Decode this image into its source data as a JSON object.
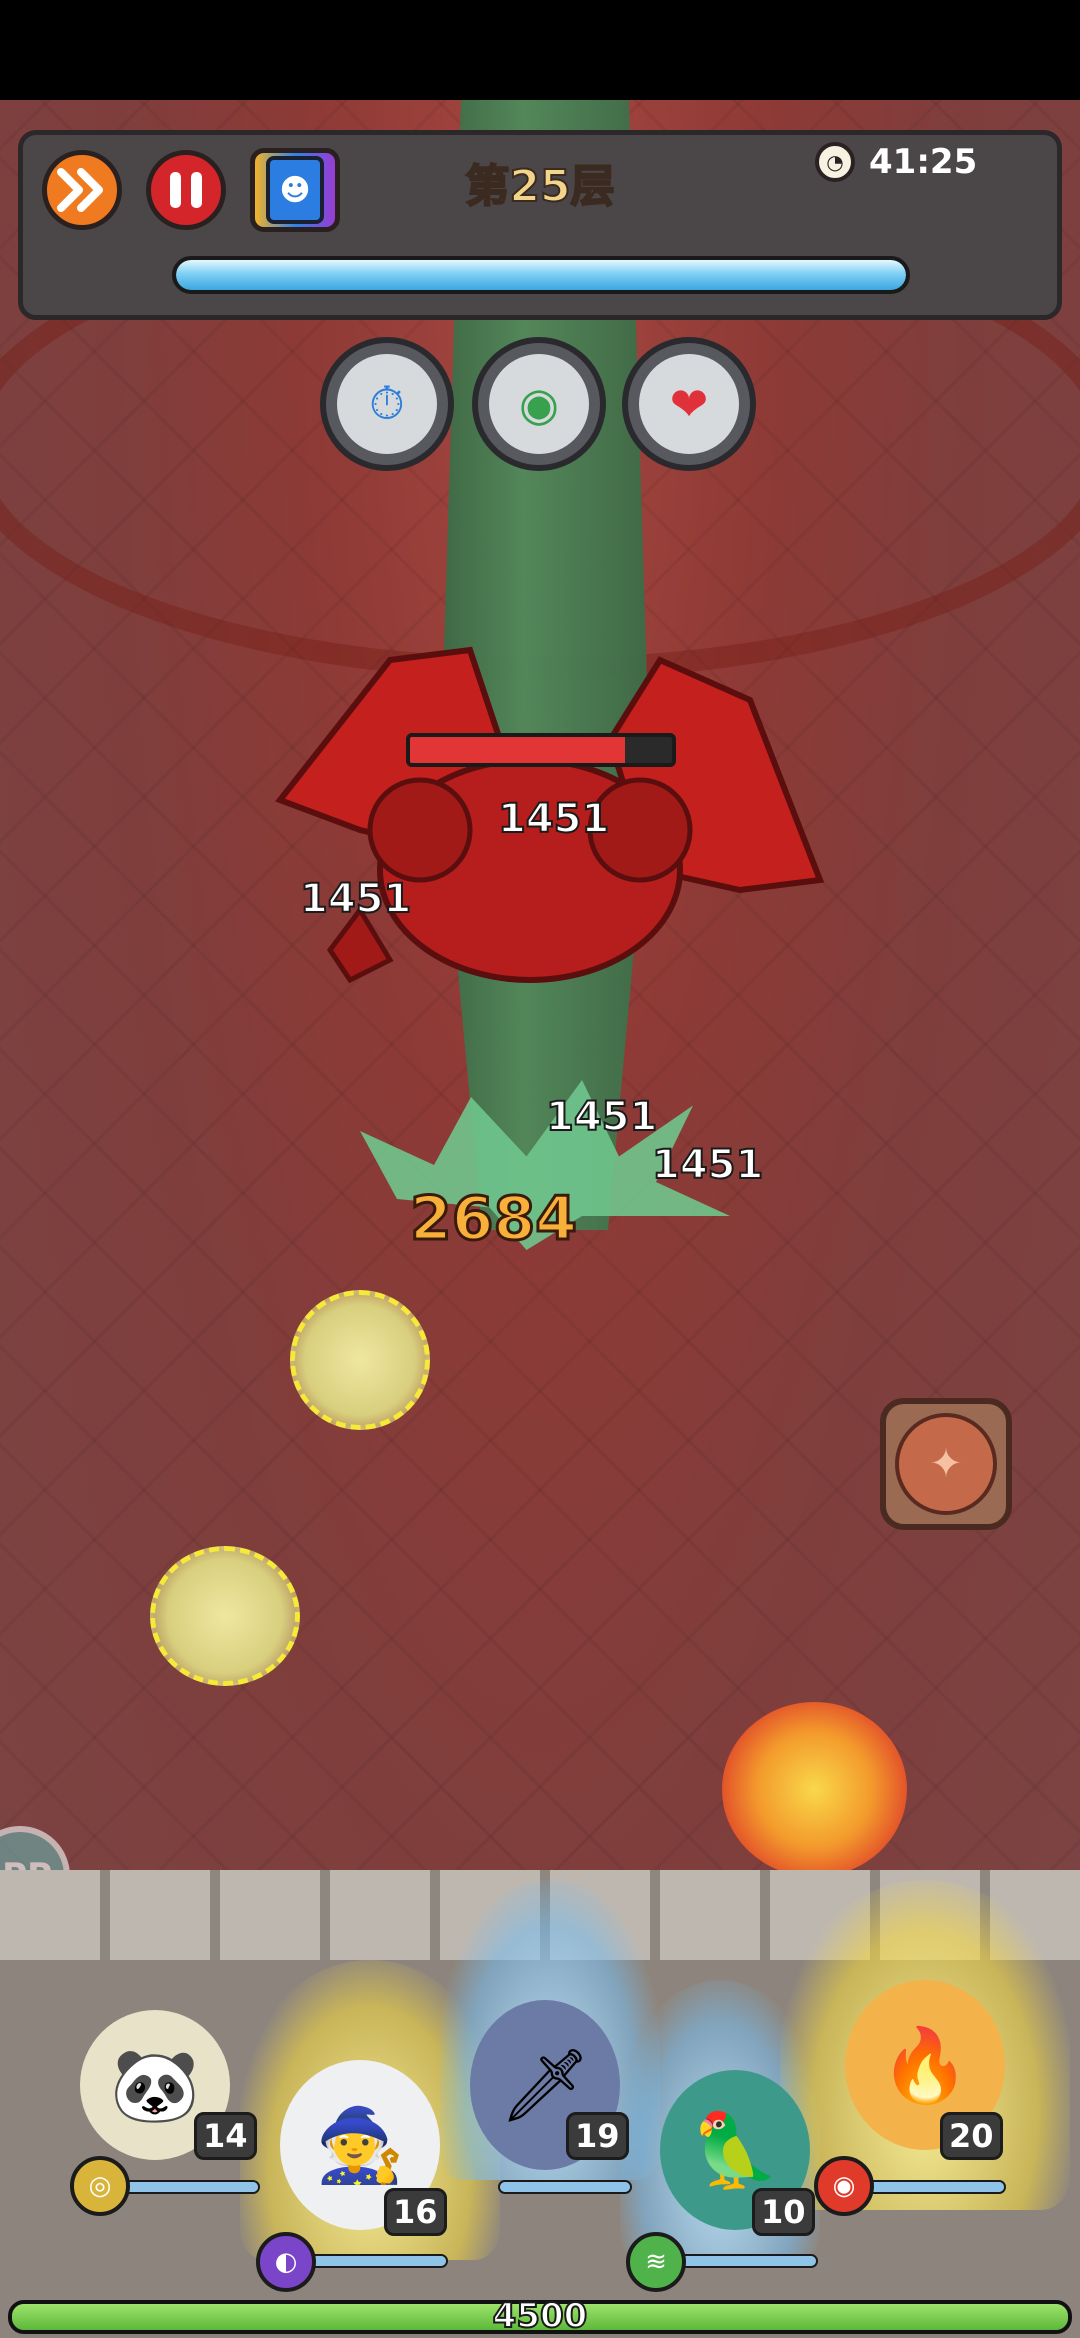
{
  "hud": {
    "floor_label": "第25层",
    "timer": "41:25",
    "wave_progress_pct": 100,
    "icons": {
      "speed": "fast-forward-icon",
      "pause": "pause-icon",
      "deck": "card-deck-icon",
      "timer": "clock-icon"
    }
  },
  "skills": [
    {
      "name": "time-slow-skill",
      "icon": "⏱"
    },
    {
      "name": "summon-skill",
      "icon": "◉"
    },
    {
      "name": "heal-skill",
      "icon": "❤"
    }
  ],
  "enemy": {
    "hp_pct": 82
  },
  "damage_numbers": [
    "1451",
    "1451",
    "1451",
    "1451",
    "2684"
  ],
  "phoenix_button": {
    "icon": "phoenix-icon",
    "glyph": "✦"
  },
  "side_tab": {
    "label": "PP"
  },
  "heroes": [
    {
      "name": "panda",
      "level": "14",
      "glyph": "🐼",
      "bar_pct": 100
    },
    {
      "name": "wizard",
      "level": "16",
      "glyph": "🧙",
      "bar_pct": 100
    },
    {
      "name": "dark-knight",
      "level": "19",
      "glyph": "🗡",
      "bar_pct": 100
    },
    {
      "name": "bird-mage",
      "level": "10",
      "glyph": "🦜",
      "bar_pct": 100
    },
    {
      "name": "fire-girl",
      "level": "20",
      "glyph": "🔥",
      "bar_pct": 100
    }
  ],
  "base": {
    "hp": "4500",
    "hp_pct": 100
  },
  "colors": {
    "hp_red": "#e23636",
    "base_green": "#5cb83a",
    "crit_orange": "#f7b03a"
  }
}
